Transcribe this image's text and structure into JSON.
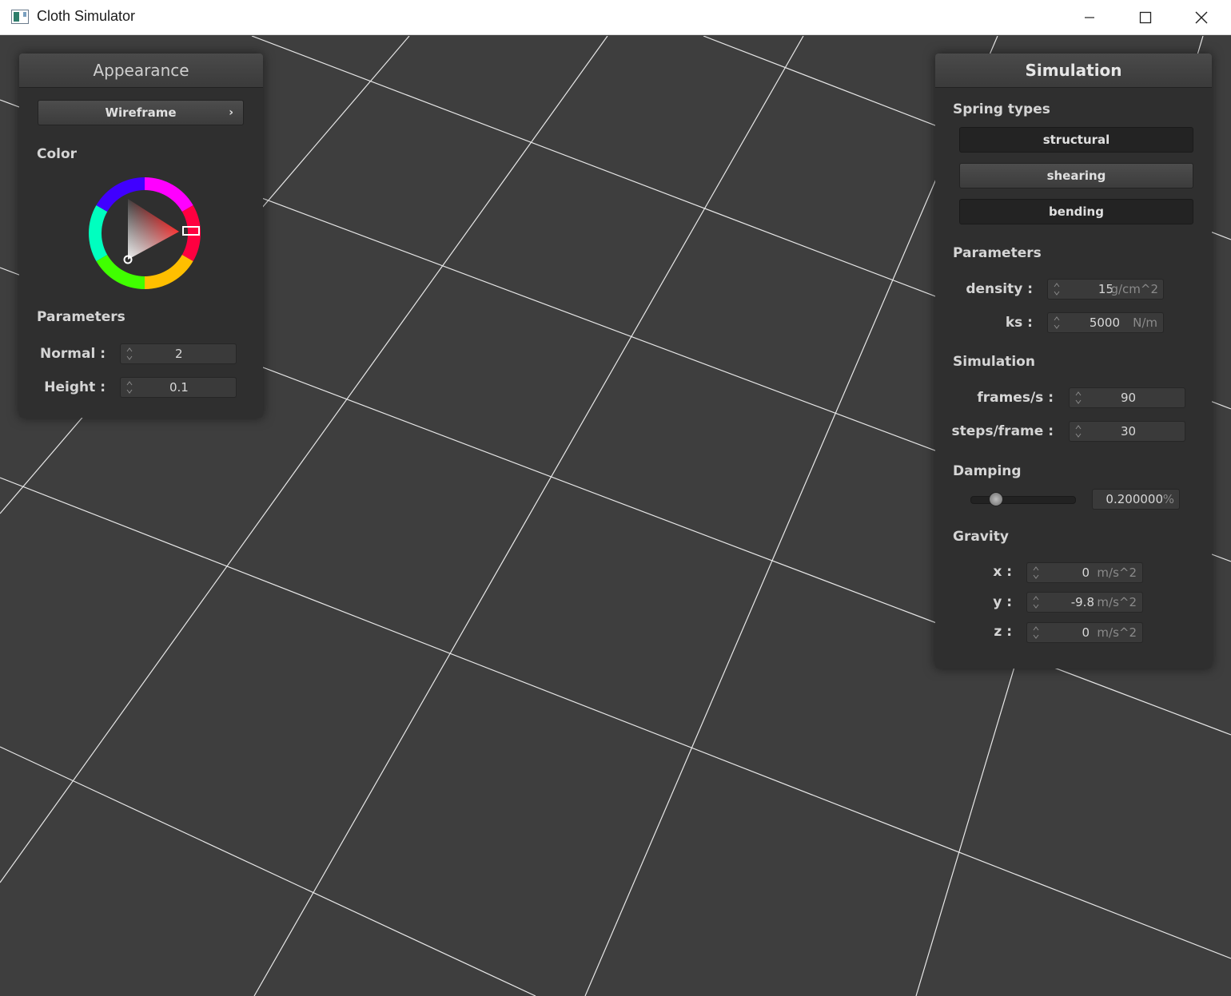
{
  "window": {
    "title": "Cloth Simulator"
  },
  "appearance": {
    "header": "Appearance",
    "mode_label": "Wireframe",
    "color_label": "Color",
    "params_label": "Parameters",
    "normal_label": "Normal :",
    "normal_value": "2",
    "height_label": "Height :",
    "height_value": "0.1",
    "selected_hue": "#ff0000"
  },
  "simulation": {
    "header": "Simulation",
    "spring_types_label": "Spring types",
    "spring_types": [
      "structural",
      "shearing",
      "bending"
    ],
    "params_label": "Parameters",
    "density_label": "density :",
    "density_value": "15",
    "density_unit": "g/cm^2",
    "ks_label": "ks :",
    "ks_value": "5000",
    "ks_unit": "N/m",
    "sim_label": "Simulation",
    "fps_label": "frames/s :",
    "fps_value": "90",
    "steps_label": "steps/frame :",
    "steps_value": "30",
    "damping_label": "Damping",
    "damping_value": "0.200000",
    "damping_unit": "%",
    "damping_level": 0.2,
    "gravity_label": "Gravity",
    "gx_label": "x :",
    "gx_value": "0",
    "gy_label": "y :",
    "gy_value": "-9.8",
    "gz_label": "z :",
    "gz_value": "0",
    "gravity_unit": "m/s^2"
  },
  "colors": {
    "background": "#3e3e3e",
    "panel": "#2f2f2f",
    "grid_line": "#e8e8e8"
  }
}
